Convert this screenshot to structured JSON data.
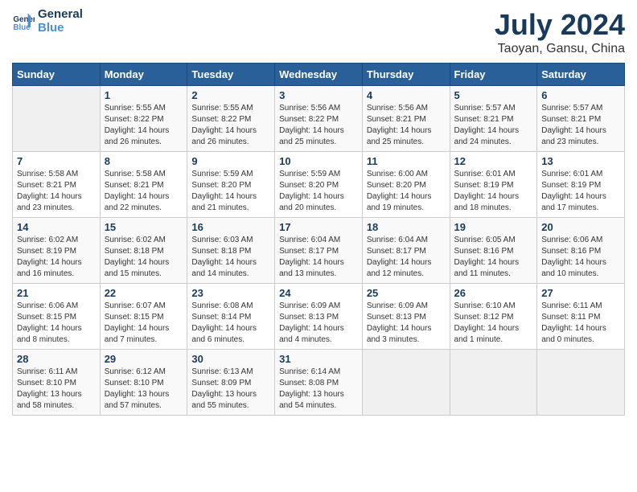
{
  "header": {
    "logo_line1": "General",
    "logo_line2": "Blue",
    "title": "July 2024",
    "subtitle": "Taoyan, Gansu, China"
  },
  "columns": [
    "Sunday",
    "Monday",
    "Tuesday",
    "Wednesday",
    "Thursday",
    "Friday",
    "Saturday"
  ],
  "weeks": [
    [
      {
        "day": "",
        "info": ""
      },
      {
        "day": "1",
        "info": "Sunrise: 5:55 AM\nSunset: 8:22 PM\nDaylight: 14 hours\nand 26 minutes."
      },
      {
        "day": "2",
        "info": "Sunrise: 5:55 AM\nSunset: 8:22 PM\nDaylight: 14 hours\nand 26 minutes."
      },
      {
        "day": "3",
        "info": "Sunrise: 5:56 AM\nSunset: 8:22 PM\nDaylight: 14 hours\nand 25 minutes."
      },
      {
        "day": "4",
        "info": "Sunrise: 5:56 AM\nSunset: 8:21 PM\nDaylight: 14 hours\nand 25 minutes."
      },
      {
        "day": "5",
        "info": "Sunrise: 5:57 AM\nSunset: 8:21 PM\nDaylight: 14 hours\nand 24 minutes."
      },
      {
        "day": "6",
        "info": "Sunrise: 5:57 AM\nSunset: 8:21 PM\nDaylight: 14 hours\nand 23 minutes."
      }
    ],
    [
      {
        "day": "7",
        "info": "Sunrise: 5:58 AM\nSunset: 8:21 PM\nDaylight: 14 hours\nand 23 minutes."
      },
      {
        "day": "8",
        "info": "Sunrise: 5:58 AM\nSunset: 8:21 PM\nDaylight: 14 hours\nand 22 minutes."
      },
      {
        "day": "9",
        "info": "Sunrise: 5:59 AM\nSunset: 8:20 PM\nDaylight: 14 hours\nand 21 minutes."
      },
      {
        "day": "10",
        "info": "Sunrise: 5:59 AM\nSunset: 8:20 PM\nDaylight: 14 hours\nand 20 minutes."
      },
      {
        "day": "11",
        "info": "Sunrise: 6:00 AM\nSunset: 8:20 PM\nDaylight: 14 hours\nand 19 minutes."
      },
      {
        "day": "12",
        "info": "Sunrise: 6:01 AM\nSunset: 8:19 PM\nDaylight: 14 hours\nand 18 minutes."
      },
      {
        "day": "13",
        "info": "Sunrise: 6:01 AM\nSunset: 8:19 PM\nDaylight: 14 hours\nand 17 minutes."
      }
    ],
    [
      {
        "day": "14",
        "info": "Sunrise: 6:02 AM\nSunset: 8:19 PM\nDaylight: 14 hours\nand 16 minutes."
      },
      {
        "day": "15",
        "info": "Sunrise: 6:02 AM\nSunset: 8:18 PM\nDaylight: 14 hours\nand 15 minutes."
      },
      {
        "day": "16",
        "info": "Sunrise: 6:03 AM\nSunset: 8:18 PM\nDaylight: 14 hours\nand 14 minutes."
      },
      {
        "day": "17",
        "info": "Sunrise: 6:04 AM\nSunset: 8:17 PM\nDaylight: 14 hours\nand 13 minutes."
      },
      {
        "day": "18",
        "info": "Sunrise: 6:04 AM\nSunset: 8:17 PM\nDaylight: 14 hours\nand 12 minutes."
      },
      {
        "day": "19",
        "info": "Sunrise: 6:05 AM\nSunset: 8:16 PM\nDaylight: 14 hours\nand 11 minutes."
      },
      {
        "day": "20",
        "info": "Sunrise: 6:06 AM\nSunset: 8:16 PM\nDaylight: 14 hours\nand 10 minutes."
      }
    ],
    [
      {
        "day": "21",
        "info": "Sunrise: 6:06 AM\nSunset: 8:15 PM\nDaylight: 14 hours\nand 8 minutes."
      },
      {
        "day": "22",
        "info": "Sunrise: 6:07 AM\nSunset: 8:15 PM\nDaylight: 14 hours\nand 7 minutes."
      },
      {
        "day": "23",
        "info": "Sunrise: 6:08 AM\nSunset: 8:14 PM\nDaylight: 14 hours\nand 6 minutes."
      },
      {
        "day": "24",
        "info": "Sunrise: 6:09 AM\nSunset: 8:13 PM\nDaylight: 14 hours\nand 4 minutes."
      },
      {
        "day": "25",
        "info": "Sunrise: 6:09 AM\nSunset: 8:13 PM\nDaylight: 14 hours\nand 3 minutes."
      },
      {
        "day": "26",
        "info": "Sunrise: 6:10 AM\nSunset: 8:12 PM\nDaylight: 14 hours\nand 1 minute."
      },
      {
        "day": "27",
        "info": "Sunrise: 6:11 AM\nSunset: 8:11 PM\nDaylight: 14 hours\nand 0 minutes."
      }
    ],
    [
      {
        "day": "28",
        "info": "Sunrise: 6:11 AM\nSunset: 8:10 PM\nDaylight: 13 hours\nand 58 minutes."
      },
      {
        "day": "29",
        "info": "Sunrise: 6:12 AM\nSunset: 8:10 PM\nDaylight: 13 hours\nand 57 minutes."
      },
      {
        "day": "30",
        "info": "Sunrise: 6:13 AM\nSunset: 8:09 PM\nDaylight: 13 hours\nand 55 minutes."
      },
      {
        "day": "31",
        "info": "Sunrise: 6:14 AM\nSunset: 8:08 PM\nDaylight: 13 hours\nand 54 minutes."
      },
      {
        "day": "",
        "info": ""
      },
      {
        "day": "",
        "info": ""
      },
      {
        "day": "",
        "info": ""
      }
    ]
  ]
}
